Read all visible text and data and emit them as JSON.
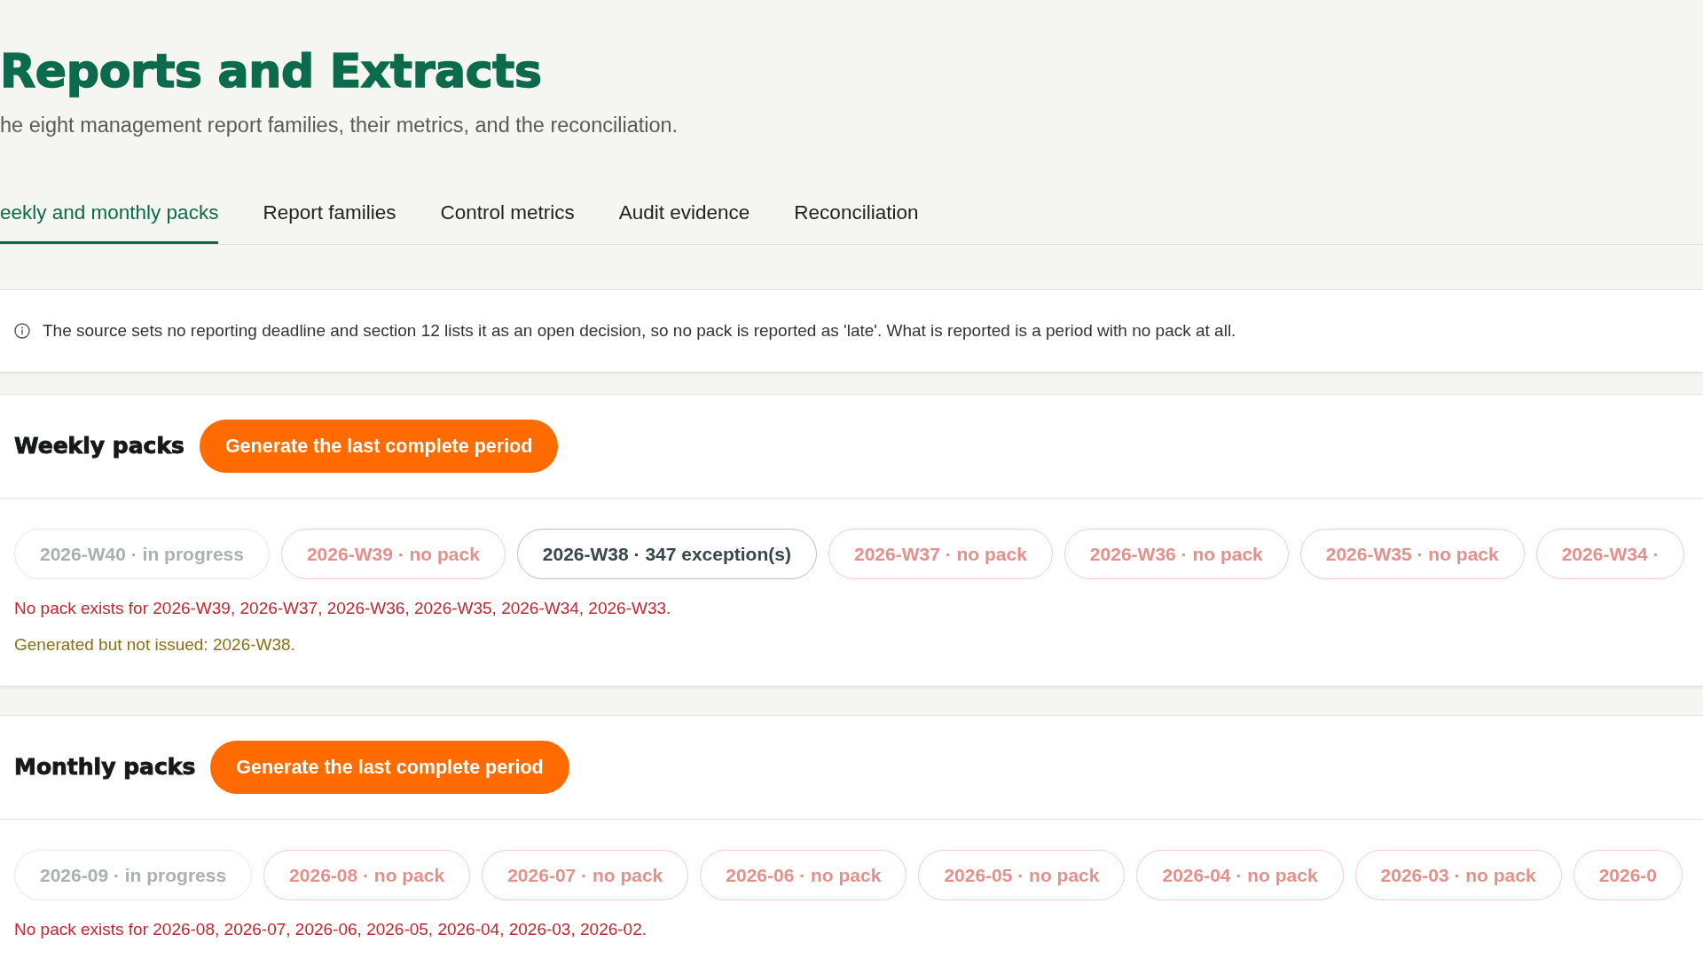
{
  "page": {
    "title": "Reports and Extracts",
    "subtitle": "he eight management report families, their metrics, and the reconciliation."
  },
  "tabs": [
    {
      "label": "eekly and monthly packs",
      "selected": true
    },
    {
      "label": "Report families",
      "selected": false
    },
    {
      "label": "Control metrics",
      "selected": false
    },
    {
      "label": "Audit evidence",
      "selected": false
    },
    {
      "label": "Reconciliation",
      "selected": false
    }
  ],
  "notice": {
    "text": "The source sets no reporting deadline and section 12 lists it as an open decision, so no pack is reported as 'late'. What is reported is a period with no pack at all."
  },
  "sections": [
    {
      "title": "Weekly packs",
      "button": "Generate the last complete period",
      "periods": [
        {
          "label": "2026-W40 · in progress",
          "kind": "progress"
        },
        {
          "label": "2026-W39 · no pack",
          "kind": "missing"
        },
        {
          "label": "2026-W38 · 347 exception(s)",
          "kind": "exceptions"
        },
        {
          "label": "2026-W37 · no pack",
          "kind": "missing"
        },
        {
          "label": "2026-W36 · no pack",
          "kind": "missing"
        },
        {
          "label": "2026-W35 · no pack",
          "kind": "missing"
        },
        {
          "label": "2026-W34 ·",
          "kind": "missing"
        }
      ],
      "notes": [
        {
          "kind": "missing",
          "text": "No pack exists for 2026-W39, 2026-W37, 2026-W36, 2026-W35, 2026-W34, 2026-W33."
        },
        {
          "kind": "unissued",
          "text": "Generated but not issued: 2026-W38."
        }
      ]
    },
    {
      "title": "Monthly packs",
      "button": "Generate the last complete period",
      "periods": [
        {
          "label": "2026-09 · in progress",
          "kind": "progress"
        },
        {
          "label": "2026-08 · no pack",
          "kind": "missing"
        },
        {
          "label": "2026-07 · no pack",
          "kind": "missing"
        },
        {
          "label": "2026-06 · no pack",
          "kind": "missing"
        },
        {
          "label": "2026-05 · no pack",
          "kind": "missing"
        },
        {
          "label": "2026-04 · no pack",
          "kind": "missing"
        },
        {
          "label": "2026-03 · no pack",
          "kind": "missing"
        },
        {
          "label": "2026-0",
          "kind": "missing"
        }
      ],
      "notes": [
        {
          "kind": "missing",
          "text": "No pack exists for 2026-08, 2026-07, 2026-06, 2026-05, 2026-04, 2026-03, 2026-02."
        }
      ]
    }
  ]
}
